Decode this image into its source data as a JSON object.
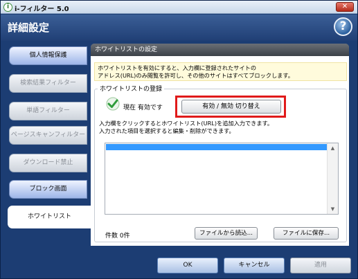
{
  "window": {
    "title": "i-フィルター 5.0",
    "close_label": "✕"
  },
  "header": {
    "page_title": "詳細設定",
    "help_label": "?"
  },
  "sidebar": {
    "items": [
      {
        "label": "個人情報保護"
      },
      {
        "label": "検索結果フィルター"
      },
      {
        "label": "単語フィルター"
      },
      {
        "label": "ページスキャンフィルター"
      },
      {
        "label": "ダウンロード禁止"
      },
      {
        "label": "ブロック画面"
      },
      {
        "label": "ホワイトリスト"
      }
    ]
  },
  "panel": {
    "title": "ホワイトリストの設定",
    "notice_line1": "ホワイトリストを有効にすると、入力欄に登録されたサイトの",
    "notice_line2": "アドレス(URL)のみ閲覧を許可し、その他のサイトはすべてブロックします。",
    "group_label": "ホワイトリストの登録",
    "status_text": "現在 有効です",
    "toggle_button": "有効 / 無効 切り替え",
    "instructions_line1": "入力欄をクリックするとホワイトリスト(URL)を追加入力できます。",
    "instructions_line2": "入力された項目を選択すると編集・削除ができます。",
    "count_text": "件数 0件",
    "load_button": "ファイルから読込...",
    "save_button": "ファイルに保存..."
  },
  "footer": {
    "ok": "OK",
    "cancel": "キャンセル",
    "apply": "適用"
  },
  "colors": {
    "highlight": "#e01a1a",
    "selection": "#3399ff",
    "header": "#203f75"
  }
}
